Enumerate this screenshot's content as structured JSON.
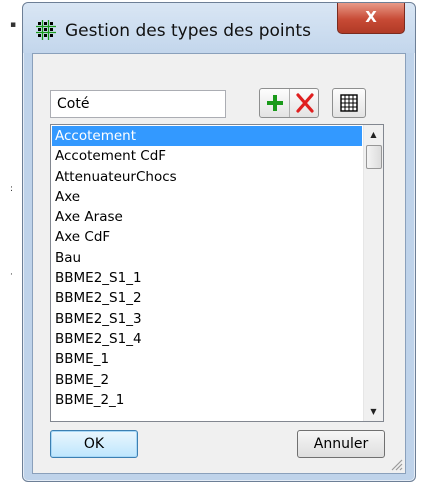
{
  "window": {
    "title": "Gestion des types des points",
    "close_label": "X"
  },
  "toolbar": {
    "name_value": "Coté",
    "add_label": "+",
    "delete_label": "✕"
  },
  "list": {
    "items": [
      "Accotement",
      "Accotement CdF",
      "AttenuateurChocs",
      "Axe",
      "Axe Arase",
      "Axe CdF",
      "Bau",
      "BBME2_S1_1",
      "BBME2_S1_2",
      "BBME2_S1_3",
      "BBME2_S1_4",
      "BBME_1",
      "BBME_2",
      "BBME_2_1"
    ],
    "selected_index": 0
  },
  "buttons": {
    "ok_label": "OK",
    "cancel_label": "Annuler"
  },
  "colors": {
    "selection": "#3399ff",
    "add_icon": "#1a9a1a",
    "delete_icon": "#e02020",
    "close_button": "#c74a35"
  }
}
